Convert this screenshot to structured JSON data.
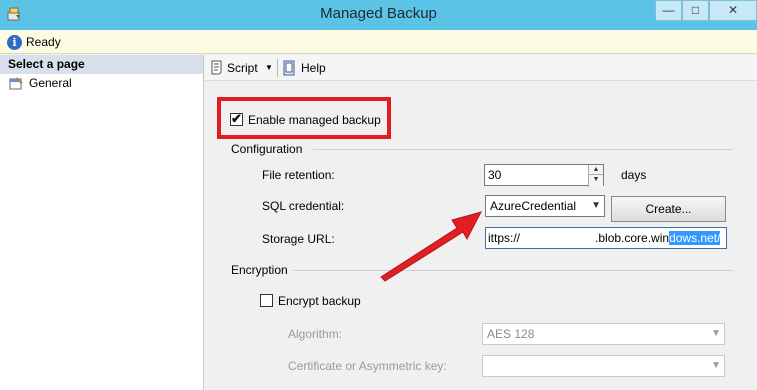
{
  "window": {
    "title": "Managed Backup",
    "minimize_glyph": "—",
    "maximize_glyph": "□",
    "close_glyph": "✕",
    "app_icon": "backup-app-icon"
  },
  "status": {
    "icon": "info-icon",
    "text": "Ready"
  },
  "left_pane": {
    "header": "Select a page",
    "pages": [
      {
        "label": "General",
        "icon": "page-wrench-icon",
        "selected": true
      }
    ]
  },
  "toolbar": {
    "script_label": "Script",
    "help_label": "Help",
    "dropdown_glyph": "▼"
  },
  "enable_managed_backup": {
    "label": "Enable managed backup",
    "checked": true
  },
  "configuration": {
    "group_label": "Configuration",
    "file_retention": {
      "label": "File retention:",
      "value": "30",
      "unit": "days"
    },
    "sql_credential": {
      "label": "SQL credential:",
      "value": "AzureCredential",
      "create_button": "Create..."
    },
    "storage_url": {
      "label": "Storage URL:",
      "value_start": "ittps://",
      "value_middle": ".blob.core.win",
      "value_selected": "dows.net/"
    }
  },
  "encryption": {
    "group_label": "Encryption",
    "encrypt_backup": {
      "label": "Encrypt backup",
      "checked": false
    },
    "algorithm": {
      "label": "Algorithm:",
      "value": "AES 128"
    },
    "certificate": {
      "label": "Certificate or Asymmetric key:",
      "value": ""
    }
  },
  "annotation_colors": {
    "highlight": "#e01e24",
    "arrow": "#e01e24"
  }
}
